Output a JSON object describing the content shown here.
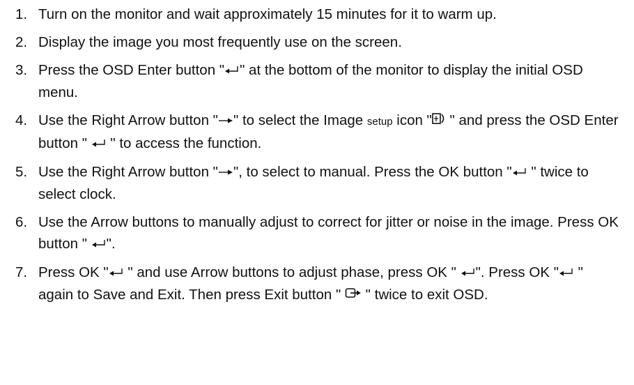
{
  "steps": [
    {
      "number": "1.",
      "text": "Turn on the monitor and wait approximately 15 minutes for it to warm up."
    },
    {
      "number": "2.",
      "text": "Display the image you most frequently use on the screen."
    },
    {
      "number": "3.",
      "a": "Press the OSD Enter button \"",
      "b": "\" at the bottom of the monitor to display the initial OSD menu."
    },
    {
      "number": "4.",
      "a": "Use the Right Arrow button \"",
      "b": "\" to select the Image ",
      "small": "setup",
      "c": " icon \"",
      "d": " \" and press the OSD Enter button \" ",
      "e": " \" to access the function."
    },
    {
      "number": "5.",
      "a": "Use the Right Arrow button \"",
      "b": "\", to select to manual. Press the OK button \"",
      "c": " \" twice to select clock."
    },
    {
      "number": "6.",
      "a": "Use the Arrow buttons to manually adjust to correct for jitter or noise in the image. Press OK button \" ",
      "b": "\"."
    },
    {
      "number": "7.",
      "a": "Press OK \"",
      "b": " \" and use Arrow buttons to adjust phase, press OK \" ",
      "c": "\". Press OK \"",
      "d": " \" again to Save and Exit. Then press Exit button \" ",
      "e": " \" twice to exit OSD."
    }
  ],
  "icons": {
    "enter": "enter-icon",
    "right_arrow": "right-arrow-icon",
    "image_setup": "image-setup-icon",
    "exit": "exit-icon"
  }
}
